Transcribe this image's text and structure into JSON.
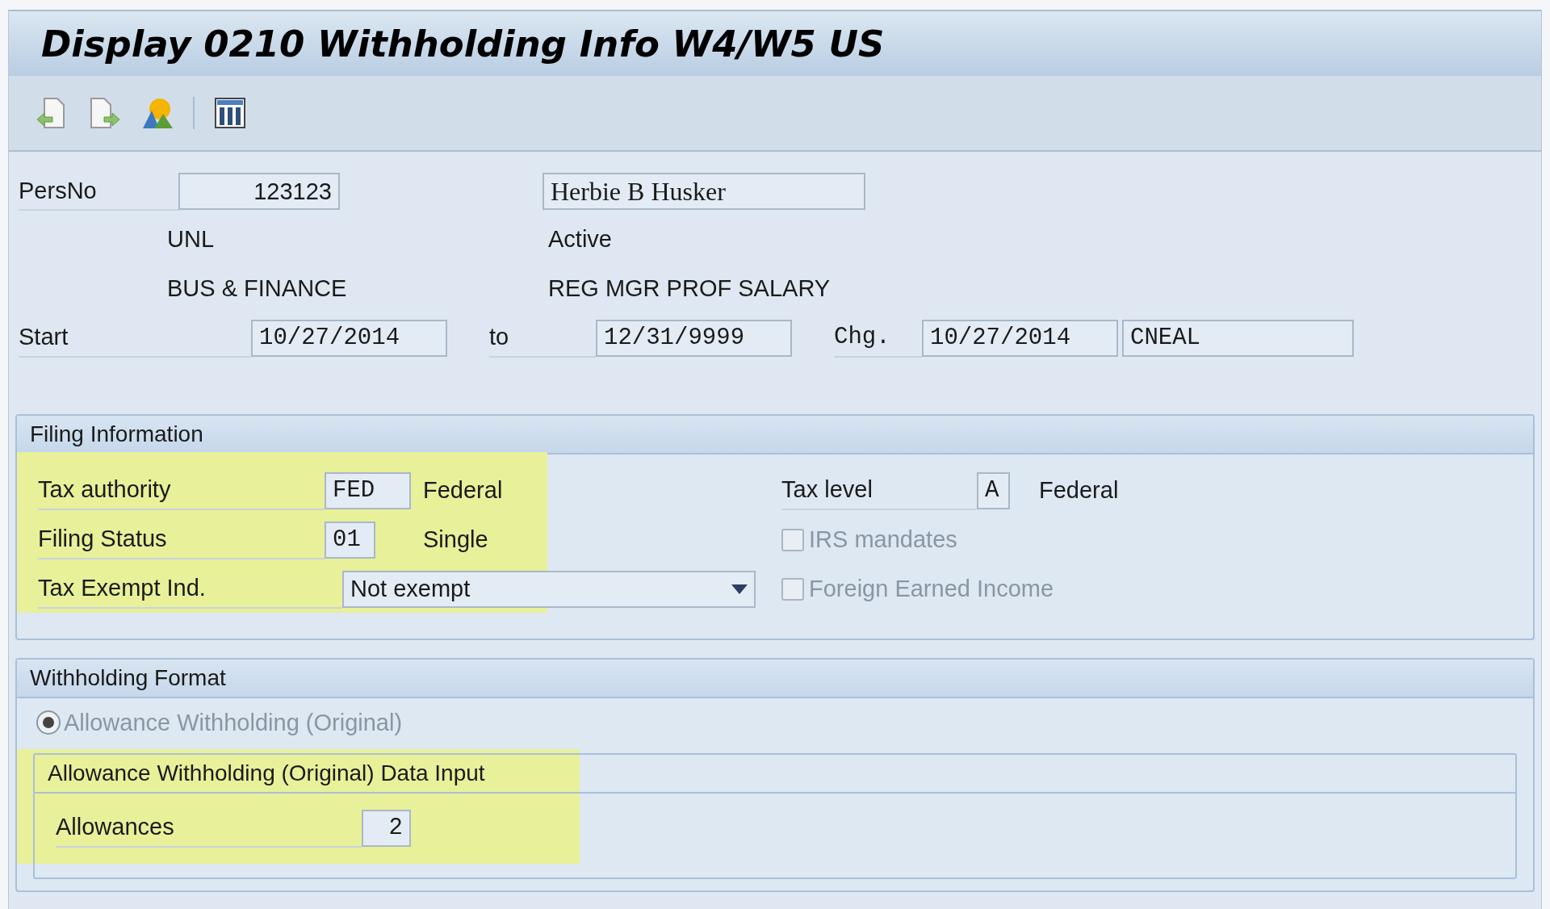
{
  "window": {
    "title": "Display 0210 Withholding Info W4/W5 US"
  },
  "header": {
    "pers_no": {
      "label": "PersNo",
      "value": "123123"
    },
    "name": "Herbie B Husker",
    "org_unit": "UNL",
    "status": "Active",
    "department": "BUS & FINANCE",
    "position": "REG MGR PROF SALARY",
    "start": {
      "label": "Start",
      "value": "10/27/2014"
    },
    "end": {
      "label": "to",
      "value": "12/31/9999"
    },
    "changed": {
      "label": "Chg.",
      "date": "10/27/2014",
      "user": "CNEAL"
    }
  },
  "filing_information": {
    "title": "Filing Information",
    "highlighted": true,
    "tax_authority": {
      "label": "Tax authority",
      "code": "FED",
      "text": "Federal"
    },
    "filing_status": {
      "label": "Filing Status",
      "code": "01",
      "text": "Single"
    },
    "tax_exempt": {
      "label": "Tax Exempt Ind.",
      "value": "Not exempt"
    },
    "tax_level": {
      "label": "Tax level",
      "code": "A",
      "text": "Federal"
    },
    "checkboxes": [
      {
        "label": "IRS mandates",
        "checked": false,
        "disabled": true
      },
      {
        "label": "Foreign Earned Income",
        "checked": false,
        "disabled": true
      }
    ]
  },
  "withholding_format": {
    "title": "Withholding Format",
    "options": [
      {
        "label": "Allowance Withholding (Original)",
        "selected": true,
        "disabled": true
      }
    ],
    "data_input": {
      "title": "Allowance Withholding (Original) Data Input",
      "highlighted": true,
      "allowances": {
        "label": "Allowances",
        "value": "2"
      }
    }
  }
}
